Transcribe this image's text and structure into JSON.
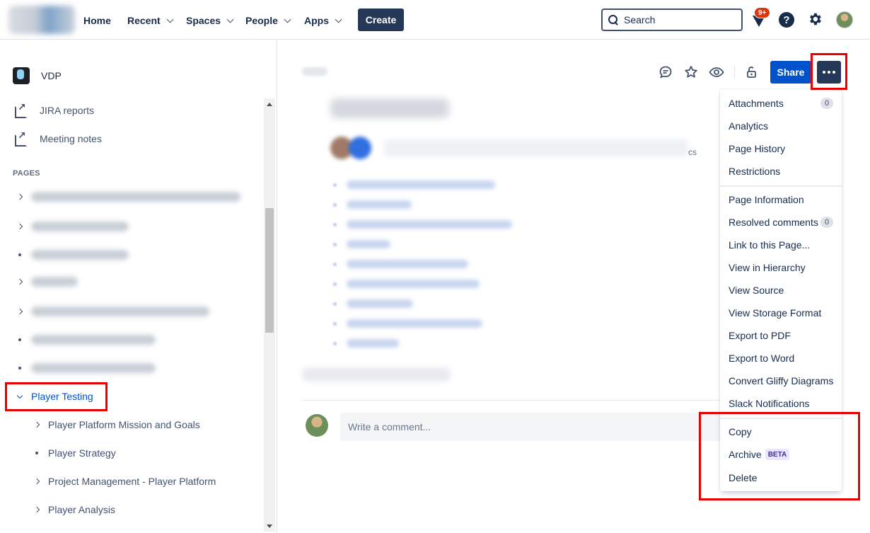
{
  "nav": {
    "items": [
      {
        "label": "Home",
        "dropdown": false
      },
      {
        "label": "Recent",
        "dropdown": true
      },
      {
        "label": "Spaces",
        "dropdown": true
      },
      {
        "label": "People",
        "dropdown": true
      },
      {
        "label": "Apps",
        "dropdown": true
      }
    ],
    "create_label": "Create",
    "search_placeholder": "Search",
    "notification_badge": "9+",
    "help_glyph": "?"
  },
  "sidebar": {
    "space_name": "VDP",
    "links": [
      {
        "label": "JIRA reports",
        "icon": "external-link-icon"
      },
      {
        "label": "Meeting notes",
        "icon": "external-link-icon"
      }
    ],
    "pages_heading": "PAGES",
    "selected_page": "Player Testing",
    "children": [
      {
        "label": "Player Platform Mission and Goals",
        "expandable": true
      },
      {
        "label": "Player Strategy",
        "expandable": false
      },
      {
        "label": "Project Management - Player Platform",
        "expandable": true
      },
      {
        "label": "Player Analysis",
        "expandable": true
      }
    ]
  },
  "page": {
    "byline_suffix": "cs",
    "comment_placeholder": "Write a comment...",
    "share_label": "Share"
  },
  "more_menu": {
    "group1": [
      {
        "label": "Attachments",
        "count": "0"
      },
      {
        "label": "Analytics"
      },
      {
        "label": "Page History"
      },
      {
        "label": "Restrictions"
      }
    ],
    "group2": [
      {
        "label": "Page Information"
      },
      {
        "label": "Resolved comments",
        "count": "0"
      },
      {
        "label": "Link to this Page..."
      },
      {
        "label": "View in Hierarchy"
      },
      {
        "label": "View Source"
      },
      {
        "label": "View Storage Format"
      },
      {
        "label": "Export to PDF"
      },
      {
        "label": "Export to Word"
      },
      {
        "label": "Convert Gliffy Diagrams"
      },
      {
        "label": "Slack Notifications"
      }
    ],
    "group3": [
      {
        "label": "Copy"
      },
      {
        "label": "Archive",
        "lozenge": "BETA"
      },
      {
        "label": "Delete"
      }
    ]
  },
  "colors": {
    "primary": "#0052cc",
    "dark_button": "#253858",
    "badge": "#de350b",
    "highlight": "#e60000"
  }
}
